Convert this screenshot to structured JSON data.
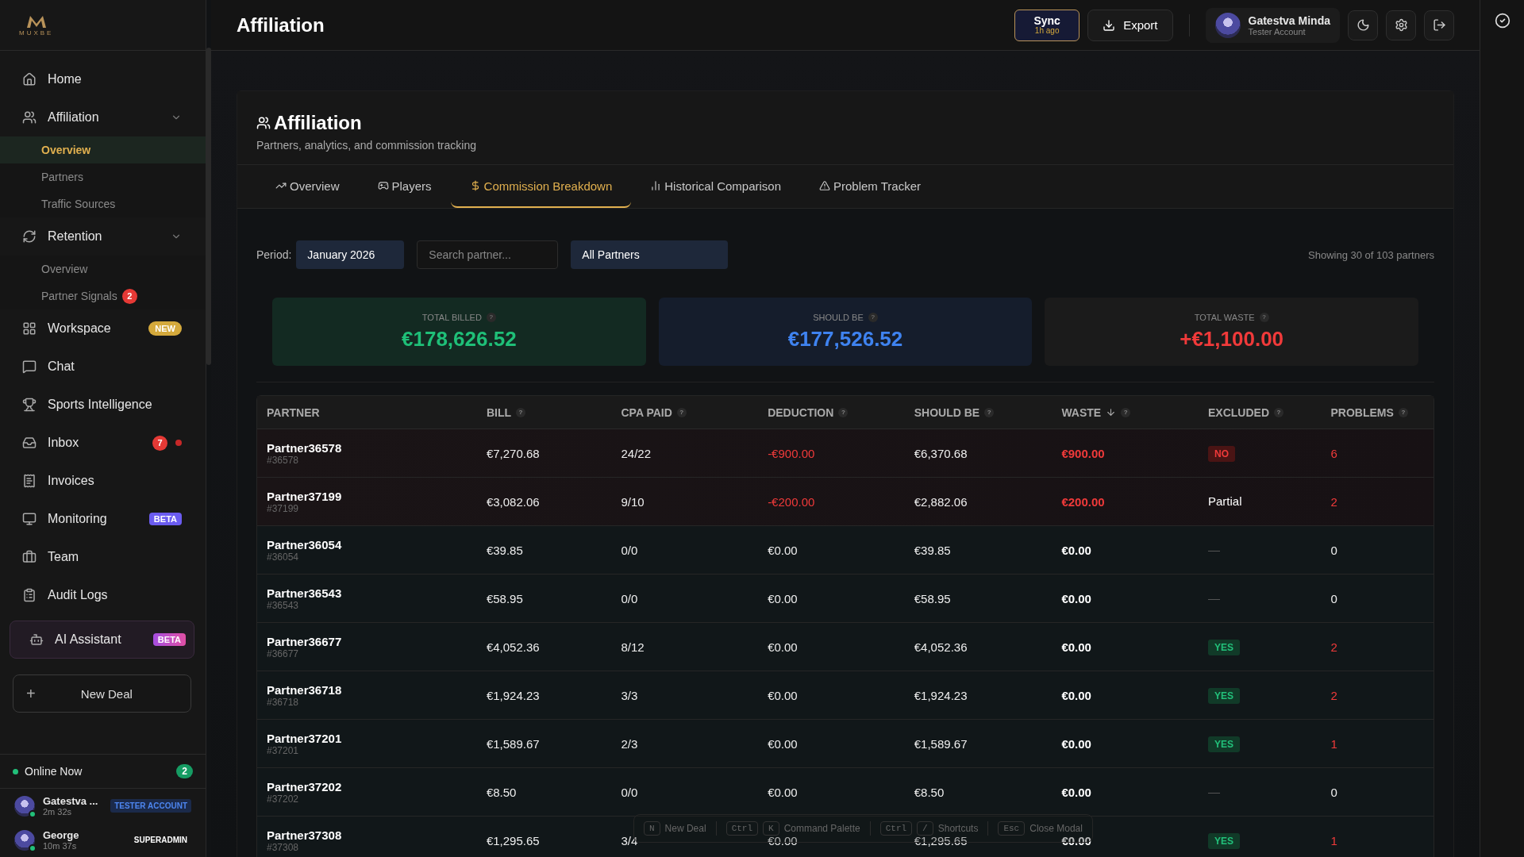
{
  "logo": {
    "text": "MUXBE"
  },
  "sidebar": {
    "items": [
      {
        "label": "Home"
      },
      {
        "label": "Affiliation",
        "expanded": true,
        "children": [
          {
            "label": "Overview",
            "selected": true
          },
          {
            "label": "Partners",
            "selected": false
          },
          {
            "label": "Traffic Sources",
            "selected": false
          }
        ]
      },
      {
        "label": "Retention",
        "expanded": true,
        "children": [
          {
            "label": "Overview",
            "selected": false
          },
          {
            "label": "Partner Signals",
            "selected": false,
            "badge": {
              "text": "2",
              "kind": "count"
            }
          }
        ]
      },
      {
        "label": "Workspace",
        "badge": {
          "text": "NEW",
          "kind": "new"
        }
      },
      {
        "label": "Chat"
      },
      {
        "label": "Sports Intelligence"
      },
      {
        "label": "Inbox",
        "badge": {
          "text": "7",
          "kind": "count-dot"
        }
      },
      {
        "label": "Invoices"
      },
      {
        "label": "Monitoring",
        "badge": {
          "text": "BETA",
          "kind": "beta"
        }
      },
      {
        "label": "Team"
      },
      {
        "label": "Audit Logs"
      }
    ],
    "assistant": {
      "label": "AI Assistant",
      "badge": {
        "text": "BETA",
        "kind": "beta-pink"
      }
    },
    "new_deal": {
      "icon": "+",
      "label": "New Deal"
    },
    "online": {
      "label": "Online Now",
      "count": "2"
    },
    "users": [
      {
        "name": "Gatestva ...",
        "time": "2m 32s",
        "role": "TESTER ACCOUNT",
        "kind": "tester"
      },
      {
        "name": "George",
        "time": "10m 37s",
        "role": "SUPERADMIN",
        "kind": "admin"
      }
    ]
  },
  "header": {
    "title": "Affiliation",
    "sync": {
      "label": "Sync",
      "time": "1h ago"
    },
    "export": "Export",
    "user": {
      "name": "Gatestva Minda",
      "role": "Tester Account"
    }
  },
  "page": {
    "title": "Affiliation",
    "subtitle": "Partners, analytics, and commission tracking"
  },
  "tabs": [
    {
      "label": "Overview",
      "selected": false
    },
    {
      "label": "Players",
      "selected": false
    },
    {
      "label": "Commission Breakdown",
      "selected": true
    },
    {
      "label": "Historical Comparison",
      "selected": false
    },
    {
      "label": "Problem Tracker",
      "selected": false
    }
  ],
  "filters": {
    "period_label": "Period:",
    "period": "January 2026",
    "search_placeholder": "Search partner...",
    "partner_filter": "All Partners",
    "showing": "Showing 30 of 103 partners"
  },
  "summary": [
    {
      "label": "TOTAL BILLED",
      "help": "?",
      "value": "€178,626.52",
      "kind": "green"
    },
    {
      "label": "SHOULD BE",
      "help": "?",
      "value": "€177,526.52",
      "kind": "blue"
    },
    {
      "label": "TOTAL WASTE",
      "help": "?",
      "value": "+€1,100.00",
      "kind": "red"
    }
  ],
  "table": {
    "columns": [
      {
        "label": "PARTNER"
      },
      {
        "label": "BILL",
        "help": "?"
      },
      {
        "label": "CPA PAID",
        "help": "?"
      },
      {
        "label": "DEDUCTION",
        "help": "?"
      },
      {
        "label": "SHOULD BE",
        "help": "?"
      },
      {
        "label": "WASTE",
        "help": "?",
        "sorted": true
      },
      {
        "label": "EXCLUDED",
        "help": "?"
      },
      {
        "label": "PROBLEMS",
        "help": "?"
      }
    ],
    "rows": [
      {
        "partner": "Partner36578",
        "id": "#36578",
        "bill": "€7,270.68",
        "cpa": "24/22",
        "deduction": "-€900.00",
        "should_be": "€6,370.68",
        "waste": "€900.00",
        "excluded": {
          "text": "NO",
          "kind": "no"
        },
        "problems": "6",
        "flagged": true,
        "has_problems": true
      },
      {
        "partner": "Partner37199",
        "id": "#37199",
        "bill": "€3,082.06",
        "cpa": "9/10",
        "deduction": "-€200.00",
        "should_be": "€2,882.06",
        "waste": "€200.00",
        "excluded": {
          "text": "Partial",
          "kind": "plain"
        },
        "problems": "2",
        "flagged": true,
        "has_problems": true
      },
      {
        "partner": "Partner36054",
        "id": "#36054",
        "bill": "€39.85",
        "cpa": "0/0",
        "deduction": "€0.00",
        "should_be": "€39.85",
        "waste": "€0.00",
        "excluded": {
          "text": "—",
          "kind": "none"
        },
        "problems": "0",
        "flagged": false,
        "has_problems": false
      },
      {
        "partner": "Partner36543",
        "id": "#36543",
        "bill": "€58.95",
        "cpa": "0/0",
        "deduction": "€0.00",
        "should_be": "€58.95",
        "waste": "€0.00",
        "excluded": {
          "text": "—",
          "kind": "none"
        },
        "problems": "0",
        "flagged": false,
        "has_problems": false
      },
      {
        "partner": "Partner36677",
        "id": "#36677",
        "bill": "€4,052.36",
        "cpa": "8/12",
        "deduction": "€0.00",
        "should_be": "€4,052.36",
        "waste": "€0.00",
        "excluded": {
          "text": "YES",
          "kind": "yes"
        },
        "problems": "2",
        "flagged": false,
        "has_problems": true
      },
      {
        "partner": "Partner36718",
        "id": "#36718",
        "bill": "€1,924.23",
        "cpa": "3/3",
        "deduction": "€0.00",
        "should_be": "€1,924.23",
        "waste": "€0.00",
        "excluded": {
          "text": "YES",
          "kind": "yes"
        },
        "problems": "2",
        "flagged": false,
        "has_problems": true
      },
      {
        "partner": "Partner37201",
        "id": "#37201",
        "bill": "€1,589.67",
        "cpa": "2/3",
        "deduction": "€0.00",
        "should_be": "€1,589.67",
        "waste": "€0.00",
        "excluded": {
          "text": "YES",
          "kind": "yes"
        },
        "problems": "1",
        "flagged": false,
        "has_problems": true
      },
      {
        "partner": "Partner37202",
        "id": "#37202",
        "bill": "€8.50",
        "cpa": "0/0",
        "deduction": "€0.00",
        "should_be": "€8.50",
        "waste": "€0.00",
        "excluded": {
          "text": "—",
          "kind": "none"
        },
        "problems": "0",
        "flagged": false,
        "has_problems": false
      },
      {
        "partner": "Partner37308",
        "id": "#37308",
        "bill": "€1,295.65",
        "cpa": "3/4",
        "deduction": "€0.00",
        "should_be": "€1,295.65",
        "waste": "€0.00",
        "excluded": {
          "text": "YES",
          "kind": "yes"
        },
        "problems": "1",
        "flagged": false,
        "has_problems": true
      }
    ]
  },
  "shortcuts": [
    {
      "keys": [
        "N"
      ],
      "label": "New Deal"
    },
    {
      "keys": [
        "Ctrl",
        "K"
      ],
      "label": "Command Palette"
    },
    {
      "keys": [
        "Ctrl",
        "/"
      ],
      "label": "Shortcuts"
    },
    {
      "keys": [
        "Esc"
      ],
      "label": "Close Modal"
    }
  ]
}
